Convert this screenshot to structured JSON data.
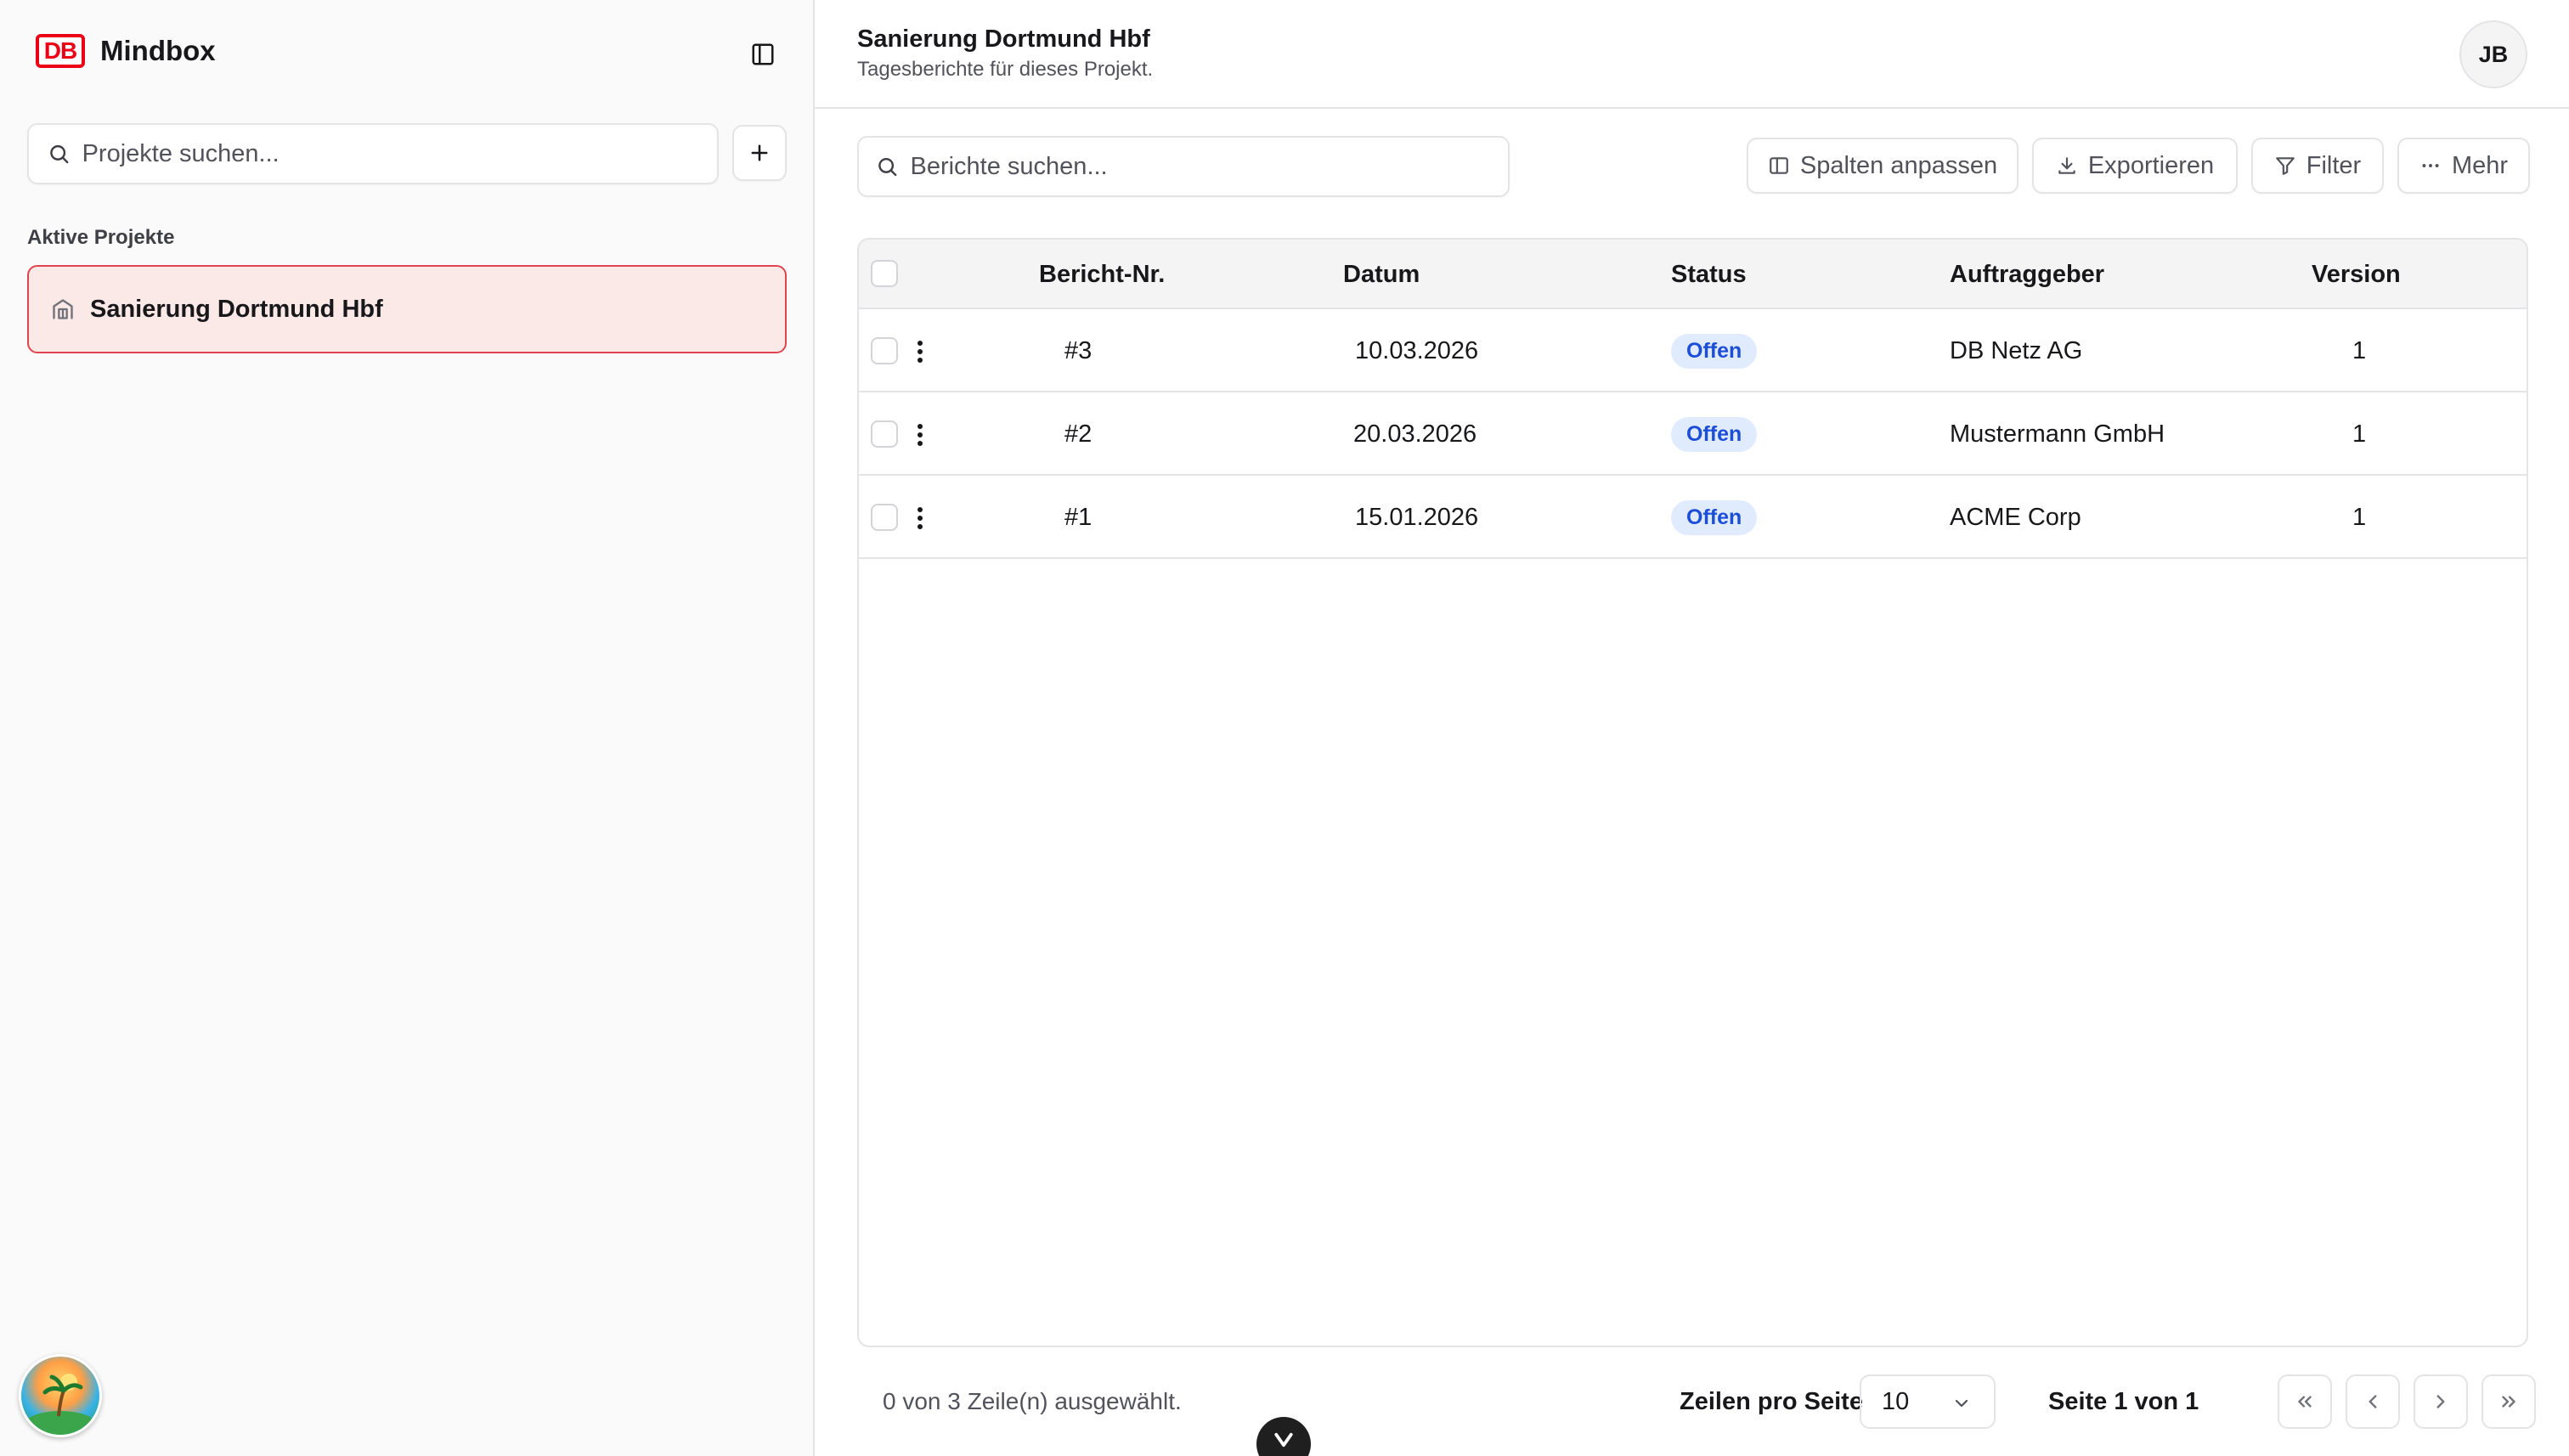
{
  "sidebar": {
    "brand": {
      "logo_text": "DB",
      "name": "Mindbox"
    },
    "search": {
      "placeholder": "Projekte suchen..."
    },
    "section_label": "Aktive Projekte",
    "projects": [
      {
        "label": "Sanierung Dortmund Hbf",
        "active": true
      }
    ]
  },
  "header": {
    "title": "Sanierung Dortmund Hbf",
    "subtitle": "Tagesberichte für dieses Projekt.",
    "user_initials": "JB"
  },
  "toolbar": {
    "search_placeholder": "Berichte suchen...",
    "columns_label": "Spalten anpassen",
    "export_label": "Exportieren",
    "filter_label": "Filter",
    "more_label": "Mehr"
  },
  "table": {
    "headers": [
      "Bericht-Nr.",
      "Datum",
      "Status",
      "Auftraggeber",
      "Version"
    ],
    "rows": [
      {
        "nr": "#3",
        "datum": "10.03.2026",
        "status": "Offen",
        "auftraggeber": "DB Netz AG",
        "version": "1"
      },
      {
        "nr": "#2",
        "datum": "20.03.2026",
        "status": "Offen",
        "auftraggeber": "Mustermann GmbH",
        "version": "1"
      },
      {
        "nr": "#1",
        "datum": "15.01.2026",
        "status": "Offen",
        "auftraggeber": "ACME Corp",
        "version": "1"
      }
    ]
  },
  "footer": {
    "selection_text": "0 von 3 Zeile(n) ausgewählt.",
    "rows_per_page_label": "Zeilen pro Seite",
    "rows_per_page_value": "10",
    "page_info": "Seite 1 von 1"
  },
  "colors": {
    "accent": "#ec0016",
    "active_bg": "#fbe9e8",
    "active_border": "#e0454f",
    "badge_bg": "#e0ecfe",
    "badge_text": "#1d4ed8"
  }
}
